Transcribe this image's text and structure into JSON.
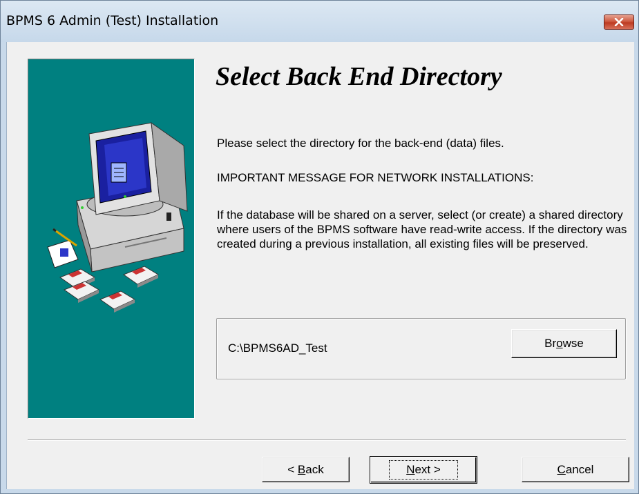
{
  "window": {
    "title": "BPMS 6 Admin (Test) Installation"
  },
  "page": {
    "heading": "Select Back End Directory",
    "instruction": "Please select the directory for the back-end (data) files.",
    "important": "IMPORTANT MESSAGE FOR NETWORK INSTALLATIONS:",
    "message": "If the database will be shared on a server, select (or create) a shared directory where users of the BPMS software have read-write access. If the directory was created during a previous installation, all existing files will be preserved."
  },
  "directory": {
    "path": "C:\\BPMS6AD_Test",
    "browse": {
      "pre": "Br",
      "key": "o",
      "post": "wse"
    }
  },
  "buttons": {
    "back": {
      "pre": "< ",
      "key": "B",
      "post": "ack"
    },
    "next": {
      "pre": "",
      "key": "N",
      "post": "ext >"
    },
    "cancel": {
      "pre": "",
      "key": "C",
      "post": "ancel"
    }
  },
  "colors": {
    "panel": "#008080",
    "monitor_screen": "#1a20a0",
    "close_button": "#c9452b"
  },
  "icons": [
    "close-icon",
    "computer-illustration",
    "floppy-disk-icon",
    "clipboard-icon"
  ]
}
